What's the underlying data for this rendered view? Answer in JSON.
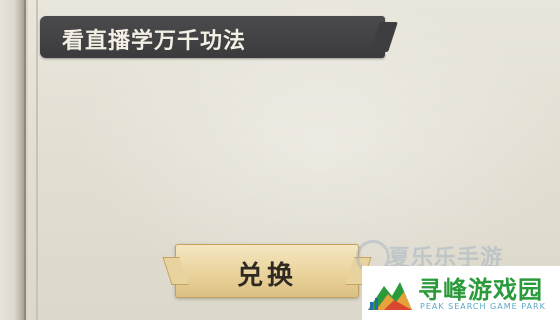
{
  "quest": {
    "title": "看直播学万千功法"
  },
  "actions": {
    "exchange_label": "兑换"
  },
  "watermark": {
    "faint_text": "夏乐乐手游",
    "name": "寻峰游戏园",
    "subtitle": "PEAK SEARCH GAME PARK",
    "logo_icon": "mountain-peak-icon",
    "colors": {
      "name": "#2a9a3a",
      "subtitle": "#5aa8c8"
    }
  },
  "colors": {
    "banner": "#3f3f41",
    "banner_text": "#f3efe4",
    "button": "#ead39c",
    "paper": "#e4e0d4"
  }
}
